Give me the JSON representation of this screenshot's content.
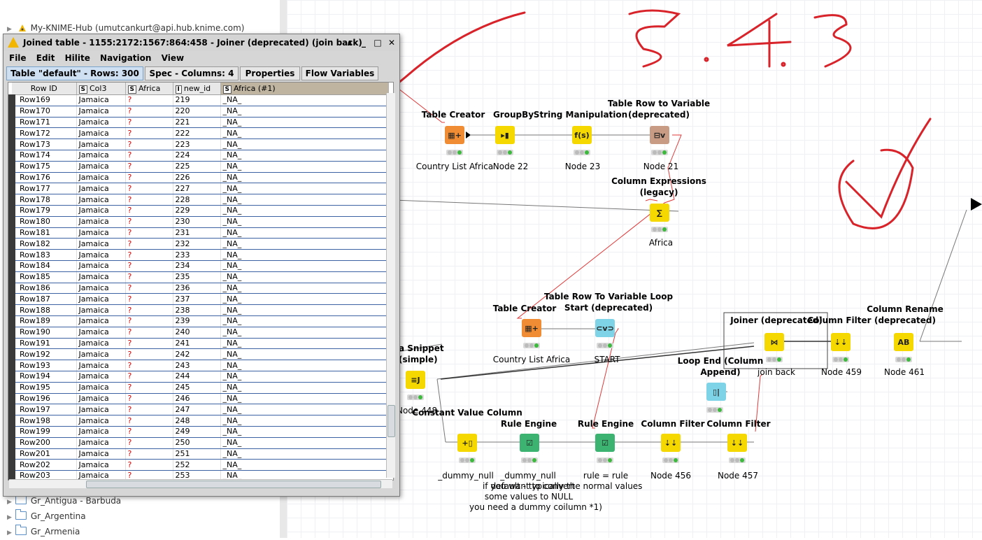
{
  "explorer": {
    "hub_label": "My-KNIME-Hub (umutcankurt@api.hub.knime.com)",
    "folders": [
      "Gr_Antigua - Barbuda",
      "Gr_Argentina",
      "Gr_Armenia"
    ]
  },
  "dialog": {
    "title": "Joined table - 1155:2172:1567:864:458 - Joiner (deprecated) (join back)",
    "menu": [
      "File",
      "Edit",
      "Hilite",
      "Navigation",
      "View"
    ],
    "tabs": [
      "Table \"default\" - Rows: 300",
      "Spec - Columns: 4",
      "Properties",
      "Flow Variables"
    ],
    "columns": [
      {
        "type": "",
        "name": "Row ID"
      },
      {
        "type": "S",
        "name": "Col3"
      },
      {
        "type": "S",
        "name": "Africa"
      },
      {
        "type": "I",
        "name": "new_id"
      },
      {
        "type": "S",
        "name": "Africa (#1)"
      }
    ],
    "rows": [
      [
        "Row169",
        "Jamaica",
        "?",
        "219",
        "_NA_"
      ],
      [
        "Row170",
        "Jamaica",
        "?",
        "220",
        "_NA_"
      ],
      [
        "Row171",
        "Jamaica",
        "?",
        "221",
        "_NA_"
      ],
      [
        "Row172",
        "Jamaica",
        "?",
        "222",
        "_NA_"
      ],
      [
        "Row173",
        "Jamaica",
        "?",
        "223",
        "_NA_"
      ],
      [
        "Row174",
        "Jamaica",
        "?",
        "224",
        "_NA_"
      ],
      [
        "Row175",
        "Jamaica",
        "?",
        "225",
        "_NA_"
      ],
      [
        "Row176",
        "Jamaica",
        "?",
        "226",
        "_NA_"
      ],
      [
        "Row177",
        "Jamaica",
        "?",
        "227",
        "_NA_"
      ],
      [
        "Row178",
        "Jamaica",
        "?",
        "228",
        "_NA_"
      ],
      [
        "Row179",
        "Jamaica",
        "?",
        "229",
        "_NA_"
      ],
      [
        "Row180",
        "Jamaica",
        "?",
        "230",
        "_NA_"
      ],
      [
        "Row181",
        "Jamaica",
        "?",
        "231",
        "_NA_"
      ],
      [
        "Row182",
        "Jamaica",
        "?",
        "232",
        "_NA_"
      ],
      [
        "Row183",
        "Jamaica",
        "?",
        "233",
        "_NA_"
      ],
      [
        "Row184",
        "Jamaica",
        "?",
        "234",
        "_NA_"
      ],
      [
        "Row185",
        "Jamaica",
        "?",
        "235",
        "_NA_"
      ],
      [
        "Row186",
        "Jamaica",
        "?",
        "236",
        "_NA_"
      ],
      [
        "Row187",
        "Jamaica",
        "?",
        "237",
        "_NA_"
      ],
      [
        "Row188",
        "Jamaica",
        "?",
        "238",
        "_NA_"
      ],
      [
        "Row189",
        "Jamaica",
        "?",
        "239",
        "_NA_"
      ],
      [
        "Row190",
        "Jamaica",
        "?",
        "240",
        "_NA_"
      ],
      [
        "Row191",
        "Jamaica",
        "?",
        "241",
        "_NA_"
      ],
      [
        "Row192",
        "Jamaica",
        "?",
        "242",
        "_NA_"
      ],
      [
        "Row193",
        "Jamaica",
        "?",
        "243",
        "_NA_"
      ],
      [
        "Row194",
        "Jamaica",
        "?",
        "244",
        "_NA_"
      ],
      [
        "Row195",
        "Jamaica",
        "?",
        "245",
        "_NA_"
      ],
      [
        "Row196",
        "Jamaica",
        "?",
        "246",
        "_NA_"
      ],
      [
        "Row197",
        "Jamaica",
        "?",
        "247",
        "_NA_"
      ],
      [
        "Row198",
        "Jamaica",
        "?",
        "248",
        "_NA_"
      ],
      [
        "Row199",
        "Jamaica",
        "?",
        "249",
        "_NA_"
      ],
      [
        "Row200",
        "Jamaica",
        "?",
        "250",
        "_NA_"
      ],
      [
        "Row201",
        "Jamaica",
        "?",
        "251",
        "_NA_"
      ],
      [
        "Row202",
        "Jamaica",
        "?",
        "252",
        "_NA_"
      ],
      [
        "Row203",
        "Jamaica",
        "?",
        "253",
        "_NA_"
      ]
    ]
  },
  "canvas": {
    "handwritten_version": "5.4.3",
    "nodes": [
      {
        "id": "table-creator-1",
        "title": "Table Creator",
        "label": "Country List Africa",
        "color": "#f08c33",
        "glyph": "▦+"
      },
      {
        "id": "groupby",
        "title": "GroupBy",
        "label": "Node 22",
        "color": "#f5d800",
        "glyph": "▸▮"
      },
      {
        "id": "string-manip",
        "title": "String Manipulation",
        "label": "Node 23",
        "color": "#f5d800",
        "glyph": "f(s)"
      },
      {
        "id": "row-to-var-1",
        "title": "Table Row to Variable (deprecated)",
        "label": "Node 21",
        "color": "#c89c84",
        "glyph": "⊟v"
      },
      {
        "id": "col-expr",
        "title": "Column Expressions (legacy)",
        "label": "Africa",
        "color": "#f5d800",
        "glyph": "∑"
      },
      {
        "id": "table-creator-2",
        "title": "Table Creator",
        "label": "Country List Africa",
        "color": "#f08c33",
        "glyph": "▦+"
      },
      {
        "id": "loop-start",
        "title": "Table Row To Variable Loop Start (deprecated)",
        "label": "START",
        "color": "#7fd3e6",
        "glyph": "⊂v⊃"
      },
      {
        "id": "java-snippet",
        "title": "a Snippet (simple)",
        "label": "Node 448",
        "color": "#f5d800",
        "glyph": "≡J"
      },
      {
        "id": "joiner",
        "title": "Joiner (deprecated)",
        "label": "join back",
        "color": "#f5d800",
        "glyph": "⋈"
      },
      {
        "id": "col-filter-459",
        "title": "Column Filter",
        "label": "Node 459",
        "color": "#f5d800",
        "glyph": "⇣⇣"
      },
      {
        "id": "col-rename",
        "title": "Column Rename (deprecated)",
        "label": "Node 461",
        "color": "#f5d800",
        "glyph": "AB"
      },
      {
        "id": "loop-end",
        "title": "Loop End (Column Append)",
        "label": "",
        "color": "#7fd3e6",
        "glyph": "▯|"
      },
      {
        "id": "const-value",
        "title": "Constant Value Column",
        "label": "_dummy_null",
        "color": "#f5d800",
        "glyph": "+▯"
      },
      {
        "id": "rule-engine-1",
        "title": "Rule Engine",
        "label": "_dummy_null",
        "color": "#f5d800",
        "glyph": "☑"
      },
      {
        "id": "rule-engine-2",
        "title": "Rule Engine",
        "label": "rule = rule",
        "color": "#3cb371",
        "glyph": "☑"
      },
      {
        "id": "col-filter-456",
        "title": "Column Filter",
        "label": "Node 456",
        "color": "#f5d800",
        "glyph": "⇣⇣"
      },
      {
        "id": "col-filter-457",
        "title": "Column Filter",
        "label": "Node 457",
        "color": "#f5d800",
        "glyph": "⇣⇣"
      }
    ],
    "annotation_lines": [
      "if you want to convert",
      "some values to NULL",
      "you need a dummy coilumn *1)"
    ],
    "annotation_overlap": "default - typically the normal values"
  }
}
